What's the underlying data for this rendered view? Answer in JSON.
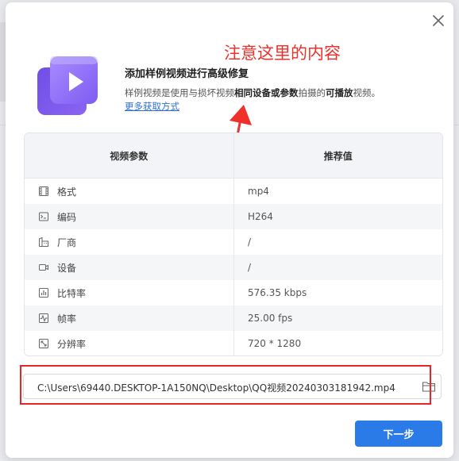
{
  "header": {
    "title": "添加样例视频进行高级修复",
    "desc_part1": "样例视频是使用与损坏视频",
    "desc_bold1": "相同设备或参数",
    "desc_part2": "拍摄的",
    "desc_bold2": "可播放",
    "desc_part3": "视频。",
    "link": "更多获取方式"
  },
  "annotation": {
    "text": "注意这里的内容",
    "color": "#f0302a"
  },
  "table": {
    "col_param": "视频参数",
    "col_recommended": "推荐值",
    "rows": [
      {
        "icon": "film-icon",
        "label": "格式",
        "value": "mp4"
      },
      {
        "icon": "terminal-icon",
        "label": "编码",
        "value": "H264"
      },
      {
        "icon": "factory-icon",
        "label": "厂商",
        "value": "/"
      },
      {
        "icon": "camera-icon",
        "label": "设备",
        "value": "/"
      },
      {
        "icon": "bar-chart-icon",
        "label": "比特率",
        "value": "576.35 kbps"
      },
      {
        "icon": "pulse-icon",
        "label": "帧率",
        "value": "25.00 fps"
      },
      {
        "icon": "resize-icon",
        "label": "分辨率",
        "value": "720 * 1280"
      }
    ]
  },
  "file": {
    "path": "C:\\Users\\69440.DESKTOP-1A150NQ\\Desktop\\QQ视频20240303181942.mp4"
  },
  "buttons": {
    "next": "下一步"
  },
  "colors": {
    "accent": "#2a7be8",
    "icon_purple": "#7c5cf0",
    "highlight_red": "#e8262a",
    "link": "#2c6fd6"
  }
}
